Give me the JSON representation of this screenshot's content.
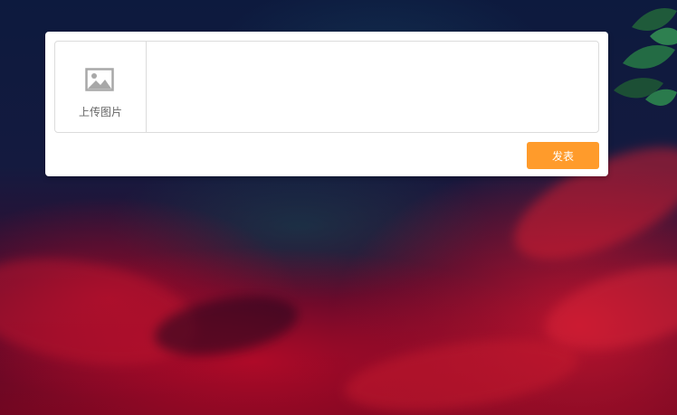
{
  "composer": {
    "upload": {
      "icon": "image-icon",
      "label": "上传图片"
    },
    "text_input": {
      "value": "",
      "placeholder": ""
    },
    "submit_label": "发表"
  },
  "colors": {
    "submit_button": "#ff9b2b",
    "card_background": "#ffffff",
    "border": "#dcdcdc",
    "label_text": "#666666"
  }
}
